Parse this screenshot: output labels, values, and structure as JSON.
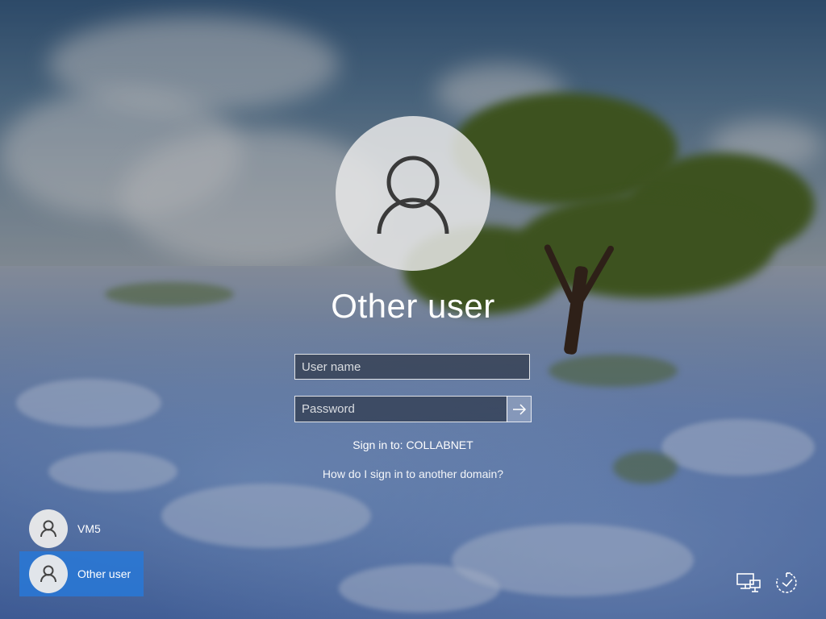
{
  "login": {
    "title": "Other user",
    "username_placeholder": "User name",
    "password_placeholder": "Password",
    "sign_in_to": "Sign in to: COLLABNET",
    "other_domain_link": "How do I sign in to another domain?"
  },
  "users": [
    {
      "name": "VM5",
      "selected": false
    },
    {
      "name": "Other user",
      "selected": true
    }
  ],
  "system_icons": [
    "network-icon",
    "accessibility-icon"
  ],
  "colors": {
    "selected_user_bg": "#2878d7",
    "field_border": "#ffffff"
  }
}
